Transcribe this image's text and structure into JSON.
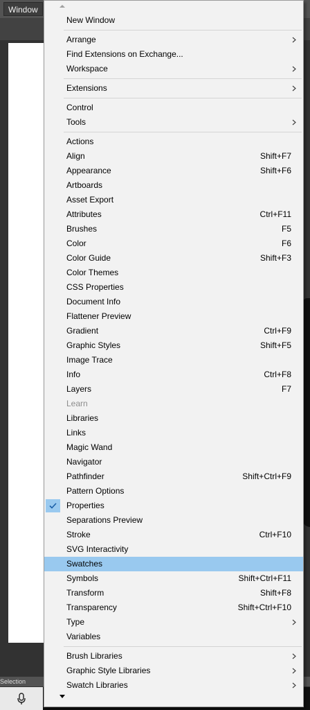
{
  "menubar": {
    "window_label": "Window"
  },
  "statusbar": {
    "tool_text": "Selection"
  },
  "menu": {
    "groups": [
      [
        {
          "label": "New Window"
        }
      ],
      [
        {
          "label": "Arrange",
          "submenu": true
        },
        {
          "label": "Find Extensions on Exchange..."
        },
        {
          "label": "Workspace",
          "submenu": true
        }
      ],
      [
        {
          "label": "Extensions",
          "submenu": true
        }
      ],
      [
        {
          "label": "Control"
        },
        {
          "label": "Tools",
          "submenu": true
        }
      ],
      [
        {
          "label": "Actions"
        },
        {
          "label": "Align",
          "shortcut": "Shift+F7"
        },
        {
          "label": "Appearance",
          "shortcut": "Shift+F6"
        },
        {
          "label": "Artboards"
        },
        {
          "label": "Asset Export"
        },
        {
          "label": "Attributes",
          "shortcut": "Ctrl+F11"
        },
        {
          "label": "Brushes",
          "shortcut": "F5"
        },
        {
          "label": "Color",
          "shortcut": "F6"
        },
        {
          "label": "Color Guide",
          "shortcut": "Shift+F3"
        },
        {
          "label": "Color Themes"
        },
        {
          "label": "CSS Properties"
        },
        {
          "label": "Document Info"
        },
        {
          "label": "Flattener Preview"
        },
        {
          "label": "Gradient",
          "shortcut": "Ctrl+F9"
        },
        {
          "label": "Graphic Styles",
          "shortcut": "Shift+F5"
        },
        {
          "label": "Image Trace"
        },
        {
          "label": "Info",
          "shortcut": "Ctrl+F8"
        },
        {
          "label": "Layers",
          "shortcut": "F7"
        },
        {
          "label": "Learn",
          "disabled": true
        },
        {
          "label": "Libraries"
        },
        {
          "label": "Links"
        },
        {
          "label": "Magic Wand"
        },
        {
          "label": "Navigator"
        },
        {
          "label": "Pathfinder",
          "shortcut": "Shift+Ctrl+F9"
        },
        {
          "label": "Pattern Options"
        },
        {
          "label": "Properties",
          "checked": true
        },
        {
          "label": "Separations Preview"
        },
        {
          "label": "Stroke",
          "shortcut": "Ctrl+F10"
        },
        {
          "label": "SVG Interactivity"
        },
        {
          "label": "Swatches",
          "highlighted": true
        },
        {
          "label": "Symbols",
          "shortcut": "Shift+Ctrl+F11"
        },
        {
          "label": "Transform",
          "shortcut": "Shift+F8"
        },
        {
          "label": "Transparency",
          "shortcut": "Shift+Ctrl+F10"
        },
        {
          "label": "Type",
          "submenu": true
        },
        {
          "label": "Variables"
        }
      ],
      [
        {
          "label": "Brush Libraries",
          "submenu": true
        },
        {
          "label": "Graphic Style Libraries",
          "submenu": true
        },
        {
          "label": "Swatch Libraries",
          "submenu": true
        }
      ]
    ]
  },
  "icons": {
    "check": "checkmark-icon",
    "submenu": "chevron-right-icon",
    "scroll_up": "scroll-up-arrow-icon",
    "scroll_down": "scroll-down-arrow-icon",
    "mic": "microphone-icon"
  },
  "colors": {
    "menu_bg": "#f2f2f2",
    "highlight": "#99c9ef",
    "checkmark": "#1a5fa8",
    "disabled_text": "#8d8d8d"
  }
}
